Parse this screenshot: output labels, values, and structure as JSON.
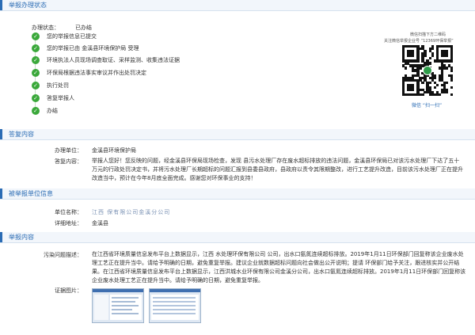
{
  "status_section": {
    "title": "举报办理状态",
    "status_label": "办理状态：",
    "status_value": "已办结",
    "steps": [
      "您的举报信息已提交",
      "您的举报已由 金溪县环境保护局 受理",
      "环境执法人员现场调查取证、采样监测、收集违法证据",
      "环保局根据违法事实审议并作出处罚决定",
      "执行处罚",
      "答复举报人",
      "办结"
    ],
    "qr_caption_line1": "微信扫描下方二维码",
    "qr_caption_line2": "关注微信举报企业号 “12369环保举报”",
    "qr_bottom_text": "微信 “扫一扫”"
  },
  "reply_section": {
    "title": "答复内容",
    "unit_label": "办理单位：",
    "unit_value": "金溪县环境保护局",
    "content_label": "答复内容：",
    "content_text": "举报人您好！您反映的问题，经金溪县环保局现场检查，发现      县污水处理厂存在废水超标排放的违法问题，金溪县环保局已对该污水处理厂下达了五十万元的行政处罚决定书，并将污水处理厂长期超标的问题汇报到县委县政府，县政府以责令其限期整改，进行工艺提升改造，目前该污水处理厂正在提升改造当中，预计在今年8月底全面完成。感谢您对环保事业的支持！"
  },
  "reported_section": {
    "title": "被举报单位信息",
    "name_label": "单位名称：",
    "name_value": "江西              保有限公司金溪分公司",
    "address_label": "详细地址：",
    "address_value": "金溪县"
  },
  "report_section": {
    "title": "举报内容",
    "desc_label": "污染问题描述：",
    "desc_text": "在江西省环境质量信息发布平台上数据显示，江西      水处理环保有限公司        公司，出水口氨氮连续超标排放。2019年1月11日环保部门回复称该企业废水处理工艺正在提升当中。请给予明确的日期，避免重复举报。建议企业就数据超标问题向社会做出公开说明；提请 环保部门给予关注，跟进核实并公开结果。在江西省环境质量信息发布平台上数据显示，江西洪城水业环保有限公司金溪分公司，出水口氨氮连续超标排放。2019年1月11日环保部门回复称该企业废水处理工艺正在提升当中。请给予明确的日期，避免重复举报。",
    "evidence_label": "证据图片："
  }
}
